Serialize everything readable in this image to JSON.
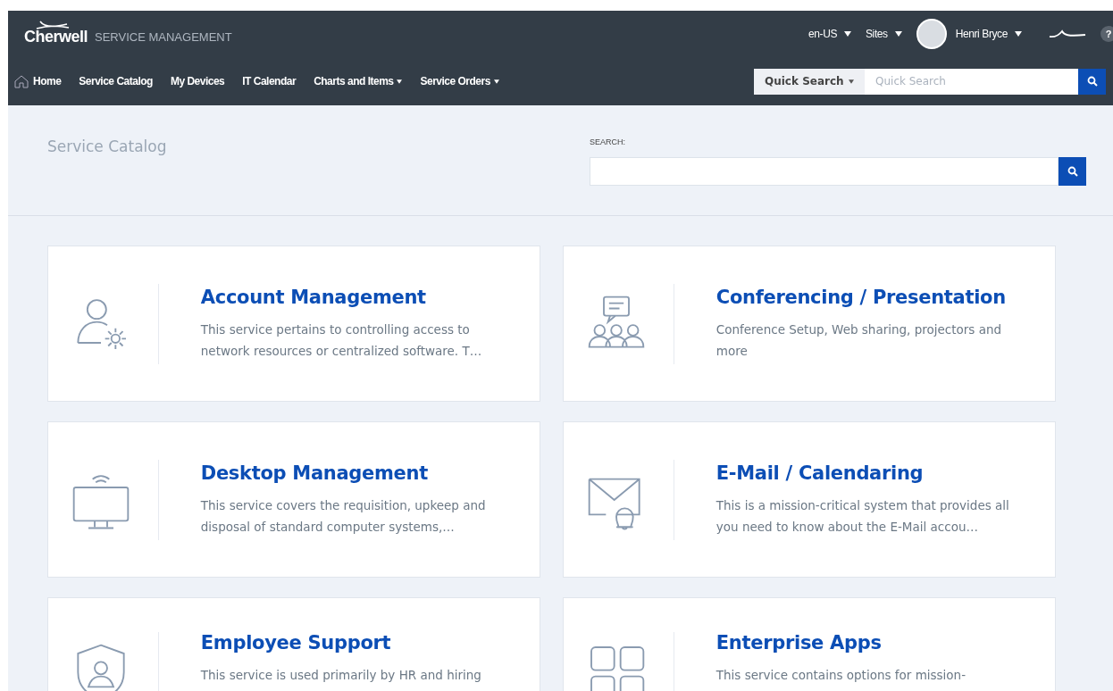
{
  "header": {
    "logo": "Cherwell",
    "product": "SERVICE MANAGEMENT",
    "locale": "en-US",
    "sites": "Sites",
    "user": "Henri Bryce",
    "help": "?"
  },
  "nav": [
    {
      "label": "Home",
      "kind": "home"
    },
    {
      "label": "Service Catalog",
      "kind": "link"
    },
    {
      "label": "My Devices",
      "kind": "link"
    },
    {
      "label": "IT Calendar",
      "kind": "link"
    },
    {
      "label": "Charts and Items",
      "kind": "menu"
    },
    {
      "label": "Service Orders",
      "kind": "menu"
    }
  ],
  "quick_search": {
    "scope": "Quick Search",
    "placeholder": "Quick Search"
  },
  "page": {
    "title": "Service Catalog",
    "search_label": "SEARCH:"
  },
  "services": [
    {
      "kind": "account",
      "title": "Account Management",
      "description": "This service pertains to controlling access to network resources or centralized software. T…"
    },
    {
      "kind": "conference",
      "title": "Conferencing / Presentation",
      "description": "Conference Setup, Web sharing, projectors and more"
    },
    {
      "kind": "desktop",
      "title": "Desktop Management",
      "description": "This service covers the requisition, upkeep and disposal of standard computer systems,…"
    },
    {
      "kind": "mail",
      "title": "E-Mail / Calendaring",
      "description": "This is a mission-critical system that provides all you need to know about the E-Mail accou…"
    },
    {
      "kind": "shield",
      "title": "Employee Support",
      "description": "This service is used primarily by HR and hiring"
    },
    {
      "kind": "apps",
      "title": "Enterprise Apps",
      "description": "This service contains options for mission-"
    }
  ]
}
